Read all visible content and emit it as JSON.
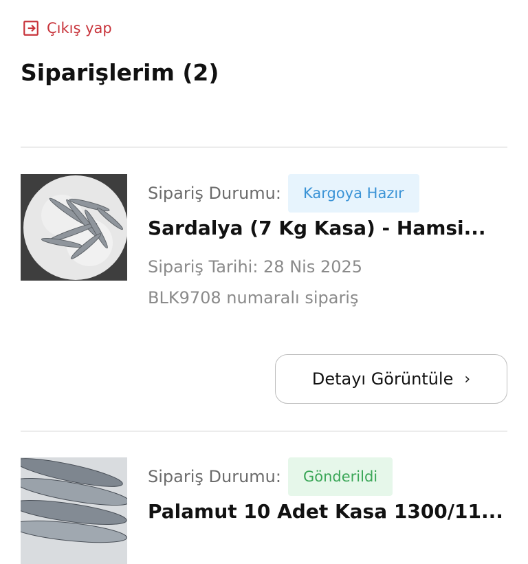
{
  "header": {
    "logout_label": "Çıkış yap",
    "page_title": "Siparişlerim (2)"
  },
  "orders": [
    {
      "status_label": "Sipariş Durumu:",
      "status": "Kargoya Hazır",
      "status_color": "#3a93d6",
      "product_name": "Sardalya (7 Kg Kasa) - Hamsi...",
      "date_text": "Sipariş Tarihi: 28 Nis 2025",
      "number_text": "BLK9708 numaralı sipariş",
      "detail_label": "Detayı Görüntüle"
    },
    {
      "status_label": "Sipariş Durumu:",
      "status": "Gönderildi",
      "status_color": "#3aa657",
      "product_name": "Palamut 10 Adet Kasa 1300/11..."
    }
  ],
  "colors": {
    "accent_red": "#c8343b",
    "divider": "#ececec"
  }
}
